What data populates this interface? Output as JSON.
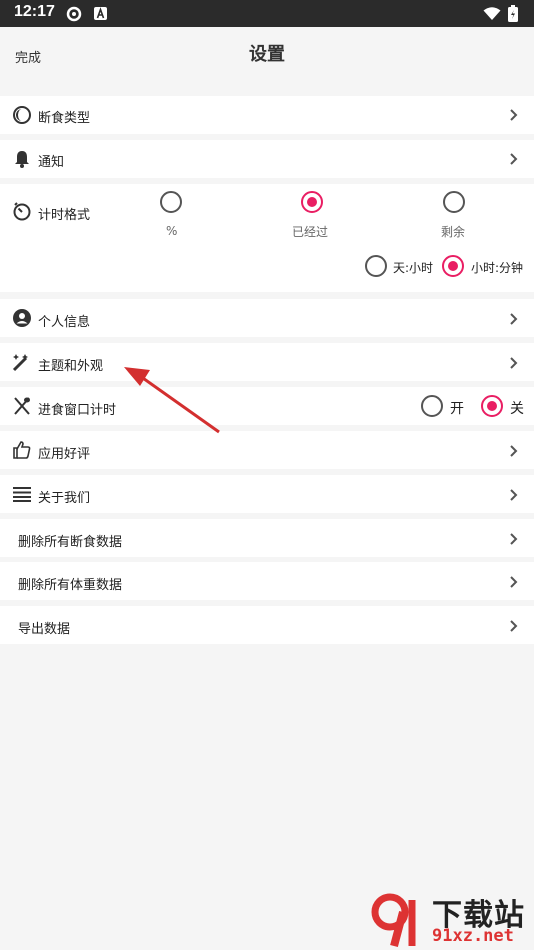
{
  "status": {
    "time": "12:17"
  },
  "header": {
    "done": "完成",
    "title": "设置"
  },
  "rows": {
    "fasting_type": "断食类型",
    "notify": "通知",
    "timer_format": "计时格式",
    "personal": "个人信息",
    "theme": "主题和外观",
    "eating_timer": "进食窗口计时",
    "rate": "应用好评",
    "about": "关于我们",
    "delete_fasting": "删除所有断食数据",
    "delete_weight": "删除所有体重数据",
    "export": "导出数据"
  },
  "timer_format": {
    "opt_percent": "%",
    "opt_elapsed": "已经过",
    "opt_remaining": "剩余",
    "opt_day_hour": "天:小时",
    "opt_hour_min": "小时:分钟"
  },
  "eating": {
    "on": "开",
    "off": "关"
  },
  "watermark": {
    "text1": "下载站",
    "text2": "91xz.net"
  },
  "colors": {
    "accent": "#e91e63",
    "arrow": "#d32f2f"
  }
}
